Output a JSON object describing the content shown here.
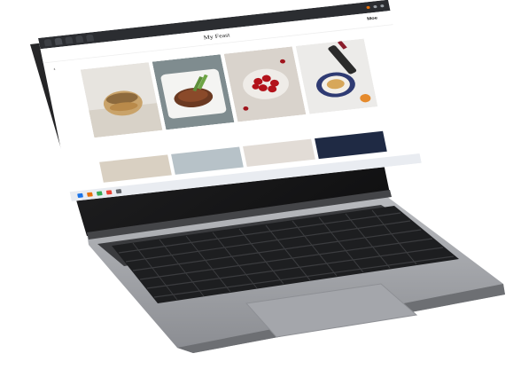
{
  "browser": {
    "tabs": [
      {
        "label": "",
        "active": false
      },
      {
        "label": "",
        "active": true
      },
      {
        "label": "",
        "active": false
      },
      {
        "label": "",
        "active": false
      },
      {
        "label": "",
        "active": false
      }
    ]
  },
  "site": {
    "title": "My Feast",
    "login_label": "Moe",
    "back_icon": "chevron-left-icon"
  },
  "cards": [
    {
      "title": "",
      "text": ""
    },
    {
      "title": "",
      "text": ""
    },
    {
      "title": "",
      "text": ""
    },
    {
      "title": "",
      "text": ""
    }
  ],
  "colors": {
    "laptop_body": "#9a9ca1",
    "keyboard": "#2a2b2e",
    "bezel": "#101010",
    "browser_chrome": "#2b2d31"
  }
}
